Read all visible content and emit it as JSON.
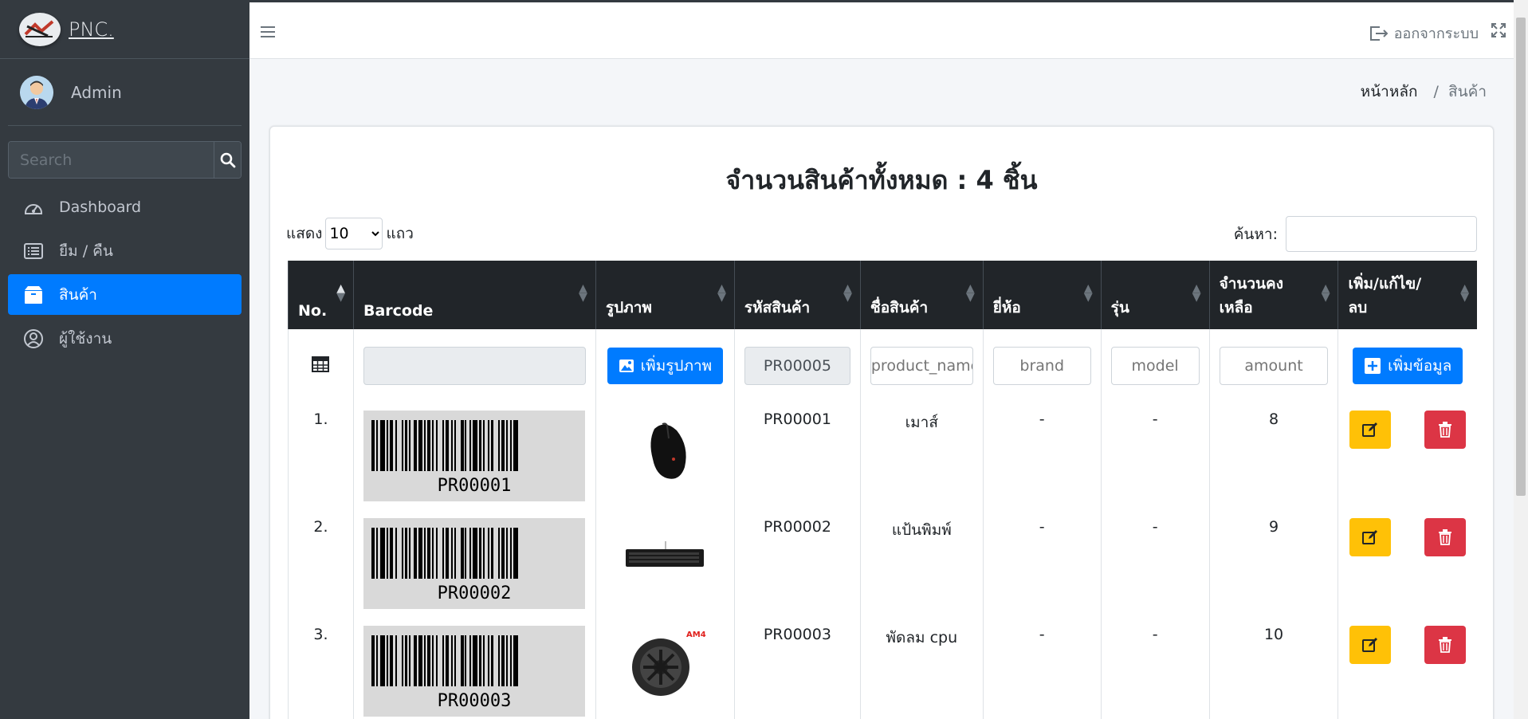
{
  "brand": {
    "name": "PNC."
  },
  "user": {
    "name": "Admin"
  },
  "sidebar": {
    "search_placeholder": "Search",
    "items": [
      {
        "label": "Dashboard",
        "icon": "dashboard-icon",
        "active": false
      },
      {
        "label": "ยืม / คืน",
        "icon": "list-icon",
        "active": false
      },
      {
        "label": "สินค้า",
        "icon": "box-icon",
        "active": true
      },
      {
        "label": "ผู้ใช้งาน",
        "icon": "user-circle-icon",
        "active": false
      }
    ]
  },
  "topbar": {
    "logout_label": "ออกจากระบบ"
  },
  "breadcrumb": {
    "home": "หน้าหลัก",
    "sep": "/",
    "current": "สินค้า"
  },
  "card": {
    "title": "จำนวนสินค้าทั้งหมด : 4 ชิ้น"
  },
  "table_controls": {
    "show_label": "แสดง",
    "rows_label": "แถว",
    "page_size": "10",
    "search_label": "ค้นหา:"
  },
  "table": {
    "headers": [
      "No.",
      "Barcode",
      "รูปภาพ",
      "รหัสสินค้า",
      "ชื่อสินค้า",
      "ยี่ห้อ",
      "รุ่น",
      "จำนวนคงเหลือ",
      "เพิ่ม/แก้ไข/ลบ"
    ],
    "header_lines": {
      "amount": [
        "จำนวนคง",
        "เหลือ"
      ],
      "actions": [
        "เพิ่ม/แก้ไข/",
        "ลบ"
      ]
    },
    "input_row": {
      "add_image_label": "เพิ่มรูปภาพ",
      "product_code": "PR00005",
      "name_placeholder": "product_name",
      "brand_placeholder": "brand",
      "model_placeholder": "model",
      "amount_placeholder": "amount",
      "add_label": "เพิ่มข้อมูล"
    },
    "rows": [
      {
        "no": "1.",
        "barcode": "PR00001",
        "code": "PR00001",
        "name": "เมาส์",
        "brand": "-",
        "model": "-",
        "amount": "8",
        "image": "mouse"
      },
      {
        "no": "2.",
        "barcode": "PR00002",
        "code": "PR00002",
        "name": "แป้นพิมพ์",
        "brand": "-",
        "model": "-",
        "amount": "9",
        "image": "keyboard"
      },
      {
        "no": "3.",
        "barcode": "PR00003",
        "code": "PR00003",
        "name": "พัดลม cpu",
        "brand": "-",
        "model": "-",
        "amount": "10",
        "image": "cpu-fan"
      }
    ]
  },
  "colors": {
    "sidebar": "#343a40",
    "primary": "#007bff",
    "warning": "#ffc107",
    "danger": "#dc3545",
    "header": "#212529"
  }
}
